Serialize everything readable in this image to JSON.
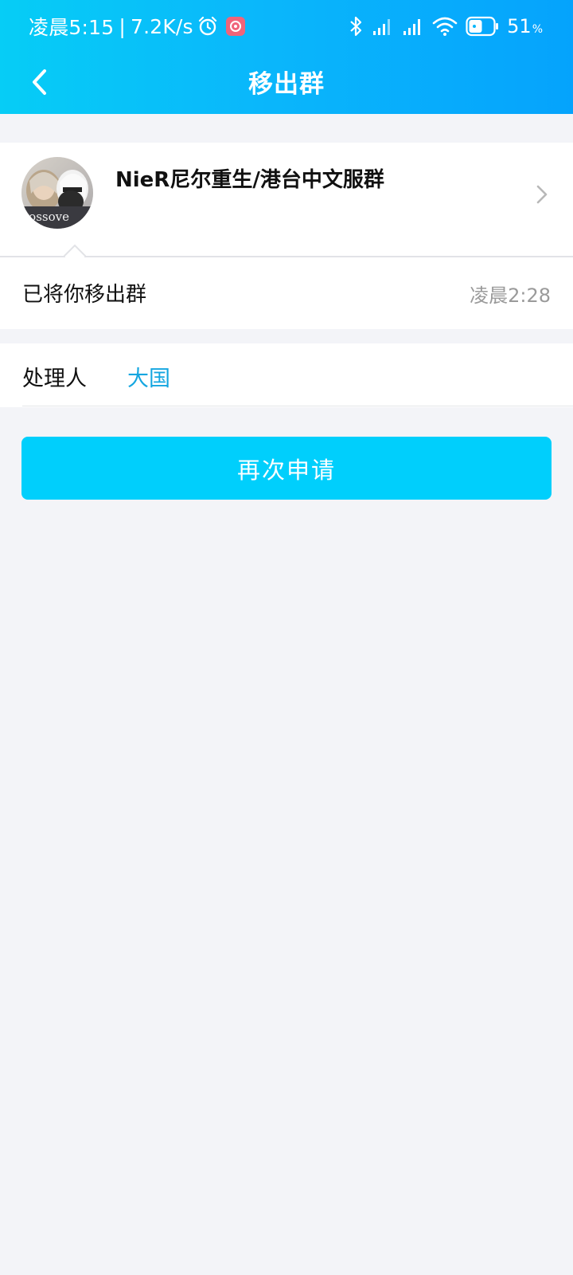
{
  "status_bar": {
    "time": "凌晨5:15",
    "separator": "|",
    "net_speed": "7.2K/s",
    "battery_level": "51",
    "battery_unit": "%",
    "icons": [
      "alarm-icon",
      "app-badge-icon",
      "bluetooth-icon",
      "signal-icon",
      "signal-icon",
      "wifi-icon",
      "battery-icon"
    ]
  },
  "header": {
    "title": "移出群",
    "back_icon": "chevron-left-icon"
  },
  "group": {
    "name": "NieR尼尔重生/港台中文服群",
    "avatar_text": "rossove",
    "notice": "已将你移出群",
    "time": "凌晨2:28"
  },
  "handler": {
    "label": "处理人",
    "name": "大国"
  },
  "actions": {
    "reapply_label": "再次申请"
  },
  "colors": {
    "header_gradient_start": "#06cdf6",
    "header_gradient_end": "#05a3fc",
    "button": "#00cffc",
    "handler_link": "#14a6e0",
    "page_background": "#f3f4f8"
  }
}
